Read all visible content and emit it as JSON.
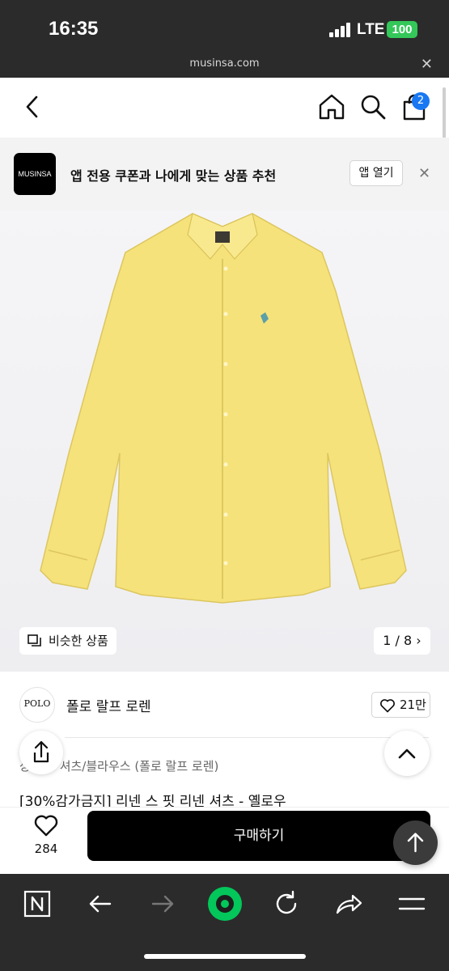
{
  "status_bar": {
    "time": "16:35",
    "network": "LTE",
    "battery": "100"
  },
  "url_bar": {
    "domain": "musinsa.com",
    "close": "✕"
  },
  "top_nav": {
    "back_icon": "chevron-left-icon",
    "home_icon": "home-icon",
    "search_icon": "search-icon",
    "cart_icon": "shopping-bag-icon",
    "cart_count": "2"
  },
  "app_banner": {
    "logo_text": "MUSINSA",
    "message": "앱 전용 쿠폰과 나에게 맞는 상품 추천",
    "open_label": "앱 열기",
    "close": "✕"
  },
  "product_image": {
    "similar_label": "비슷한 상품",
    "counter": "1 / 8",
    "counter_arrow": "›",
    "shirt_color": "#f6e27a"
  },
  "brand": {
    "logo_text": "POLO",
    "name": "폴로 랄프 로렌",
    "likes": "21만"
  },
  "product": {
    "category": "상의 > 셔츠/블라우스 (폴로 랄프 로렌)",
    "title": "[30%감가금지] 리넨 스 핏 리넨 셔츠 - 옐로우"
  },
  "bottom_bar": {
    "like_count": "284",
    "buy_label": "구매하기"
  },
  "browser_bar": {
    "icons": [
      "n-logo-icon",
      "back-arrow-icon",
      "forward-arrow-icon",
      "naver-green-icon",
      "refresh-icon",
      "share-icon",
      "menu-icon"
    ]
  },
  "colors": {
    "accent_blue": "#1877f2",
    "battery_green": "#34c759",
    "browser_green": "#03c75a"
  }
}
